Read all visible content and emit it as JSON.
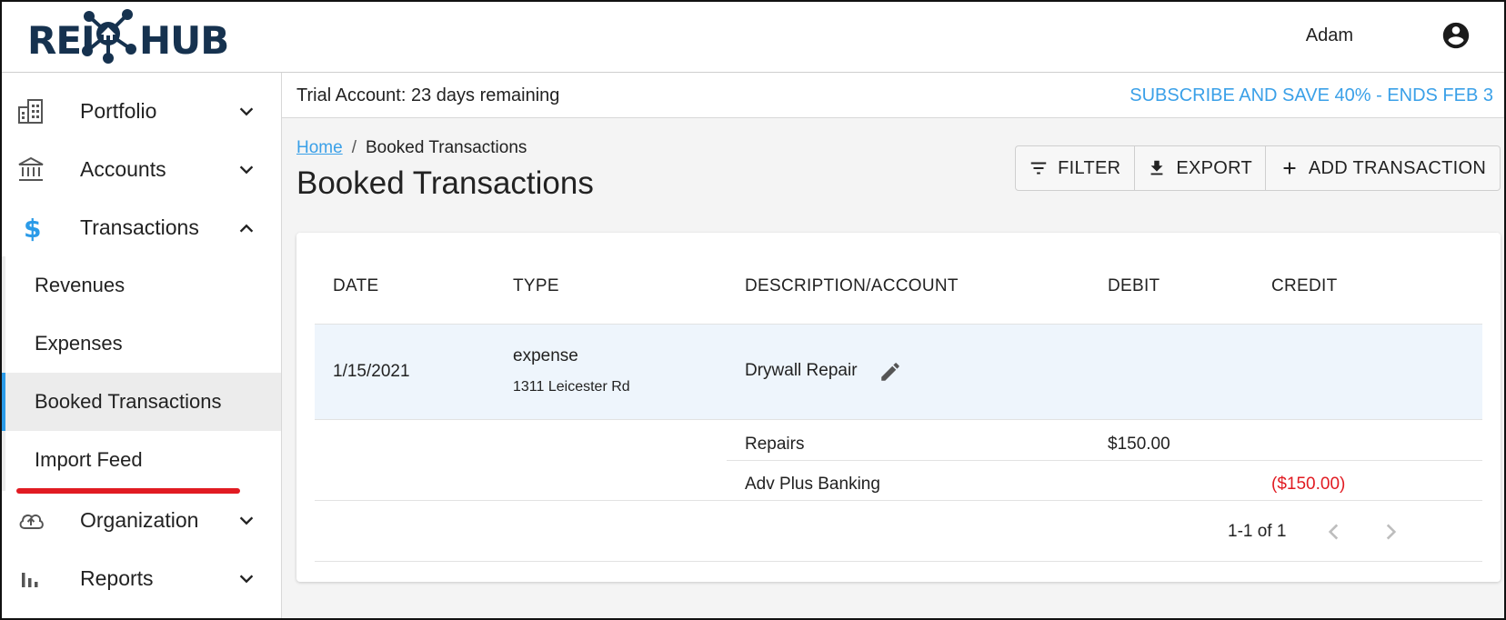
{
  "brand": {
    "logo_left": "REI",
    "logo_right": "HUB",
    "navy": "#16324f",
    "accent": "#3aa0e8",
    "highlight": "#e11b22"
  },
  "header": {
    "user_name": "Adam",
    "user_icon": "account-circle-icon"
  },
  "sidebar": {
    "items": [
      {
        "label": "Portfolio",
        "icon": "building-icon",
        "expanded": false
      },
      {
        "label": "Accounts",
        "icon": "bank-icon",
        "expanded": false
      },
      {
        "label": "Transactions",
        "icon": "dollar-icon",
        "expanded": true,
        "children": [
          {
            "label": "Revenues"
          },
          {
            "label": "Expenses"
          },
          {
            "label": "Booked Transactions",
            "active": true
          },
          {
            "label": "Import Feed"
          }
        ]
      },
      {
        "label": "Organization",
        "icon": "cloud-upload-icon",
        "expanded": false
      },
      {
        "label": "Reports",
        "icon": "bar-chart-icon",
        "expanded": false
      }
    ]
  },
  "trial": {
    "message": "Trial Account: 23 days remaining",
    "cta": "SUBSCRIBE AND SAVE 40% - ENDS FEB 3"
  },
  "breadcrumb": {
    "home": "Home",
    "separator": "/",
    "current": "Booked Transactions"
  },
  "page": {
    "title": "Booked Transactions"
  },
  "toolbar": {
    "filter_label": "FILTER",
    "export_label": "EXPORT",
    "add_label": "ADD TRANSACTION"
  },
  "table": {
    "columns": [
      "DATE",
      "TYPE",
      "DESCRIPTION/ACCOUNT",
      "DEBIT",
      "CREDIT"
    ],
    "transaction": {
      "date": "1/15/2021",
      "type": "expense",
      "property": "1311 Leicester Rd",
      "description": "Drywall Repair",
      "lines": [
        {
          "account": "Repairs",
          "debit": "$150.00",
          "credit": ""
        },
        {
          "account": "Adv Plus Banking",
          "debit": "",
          "credit": "($150.00)"
        }
      ]
    },
    "pagination": {
      "range": "1-1 of 1"
    }
  }
}
